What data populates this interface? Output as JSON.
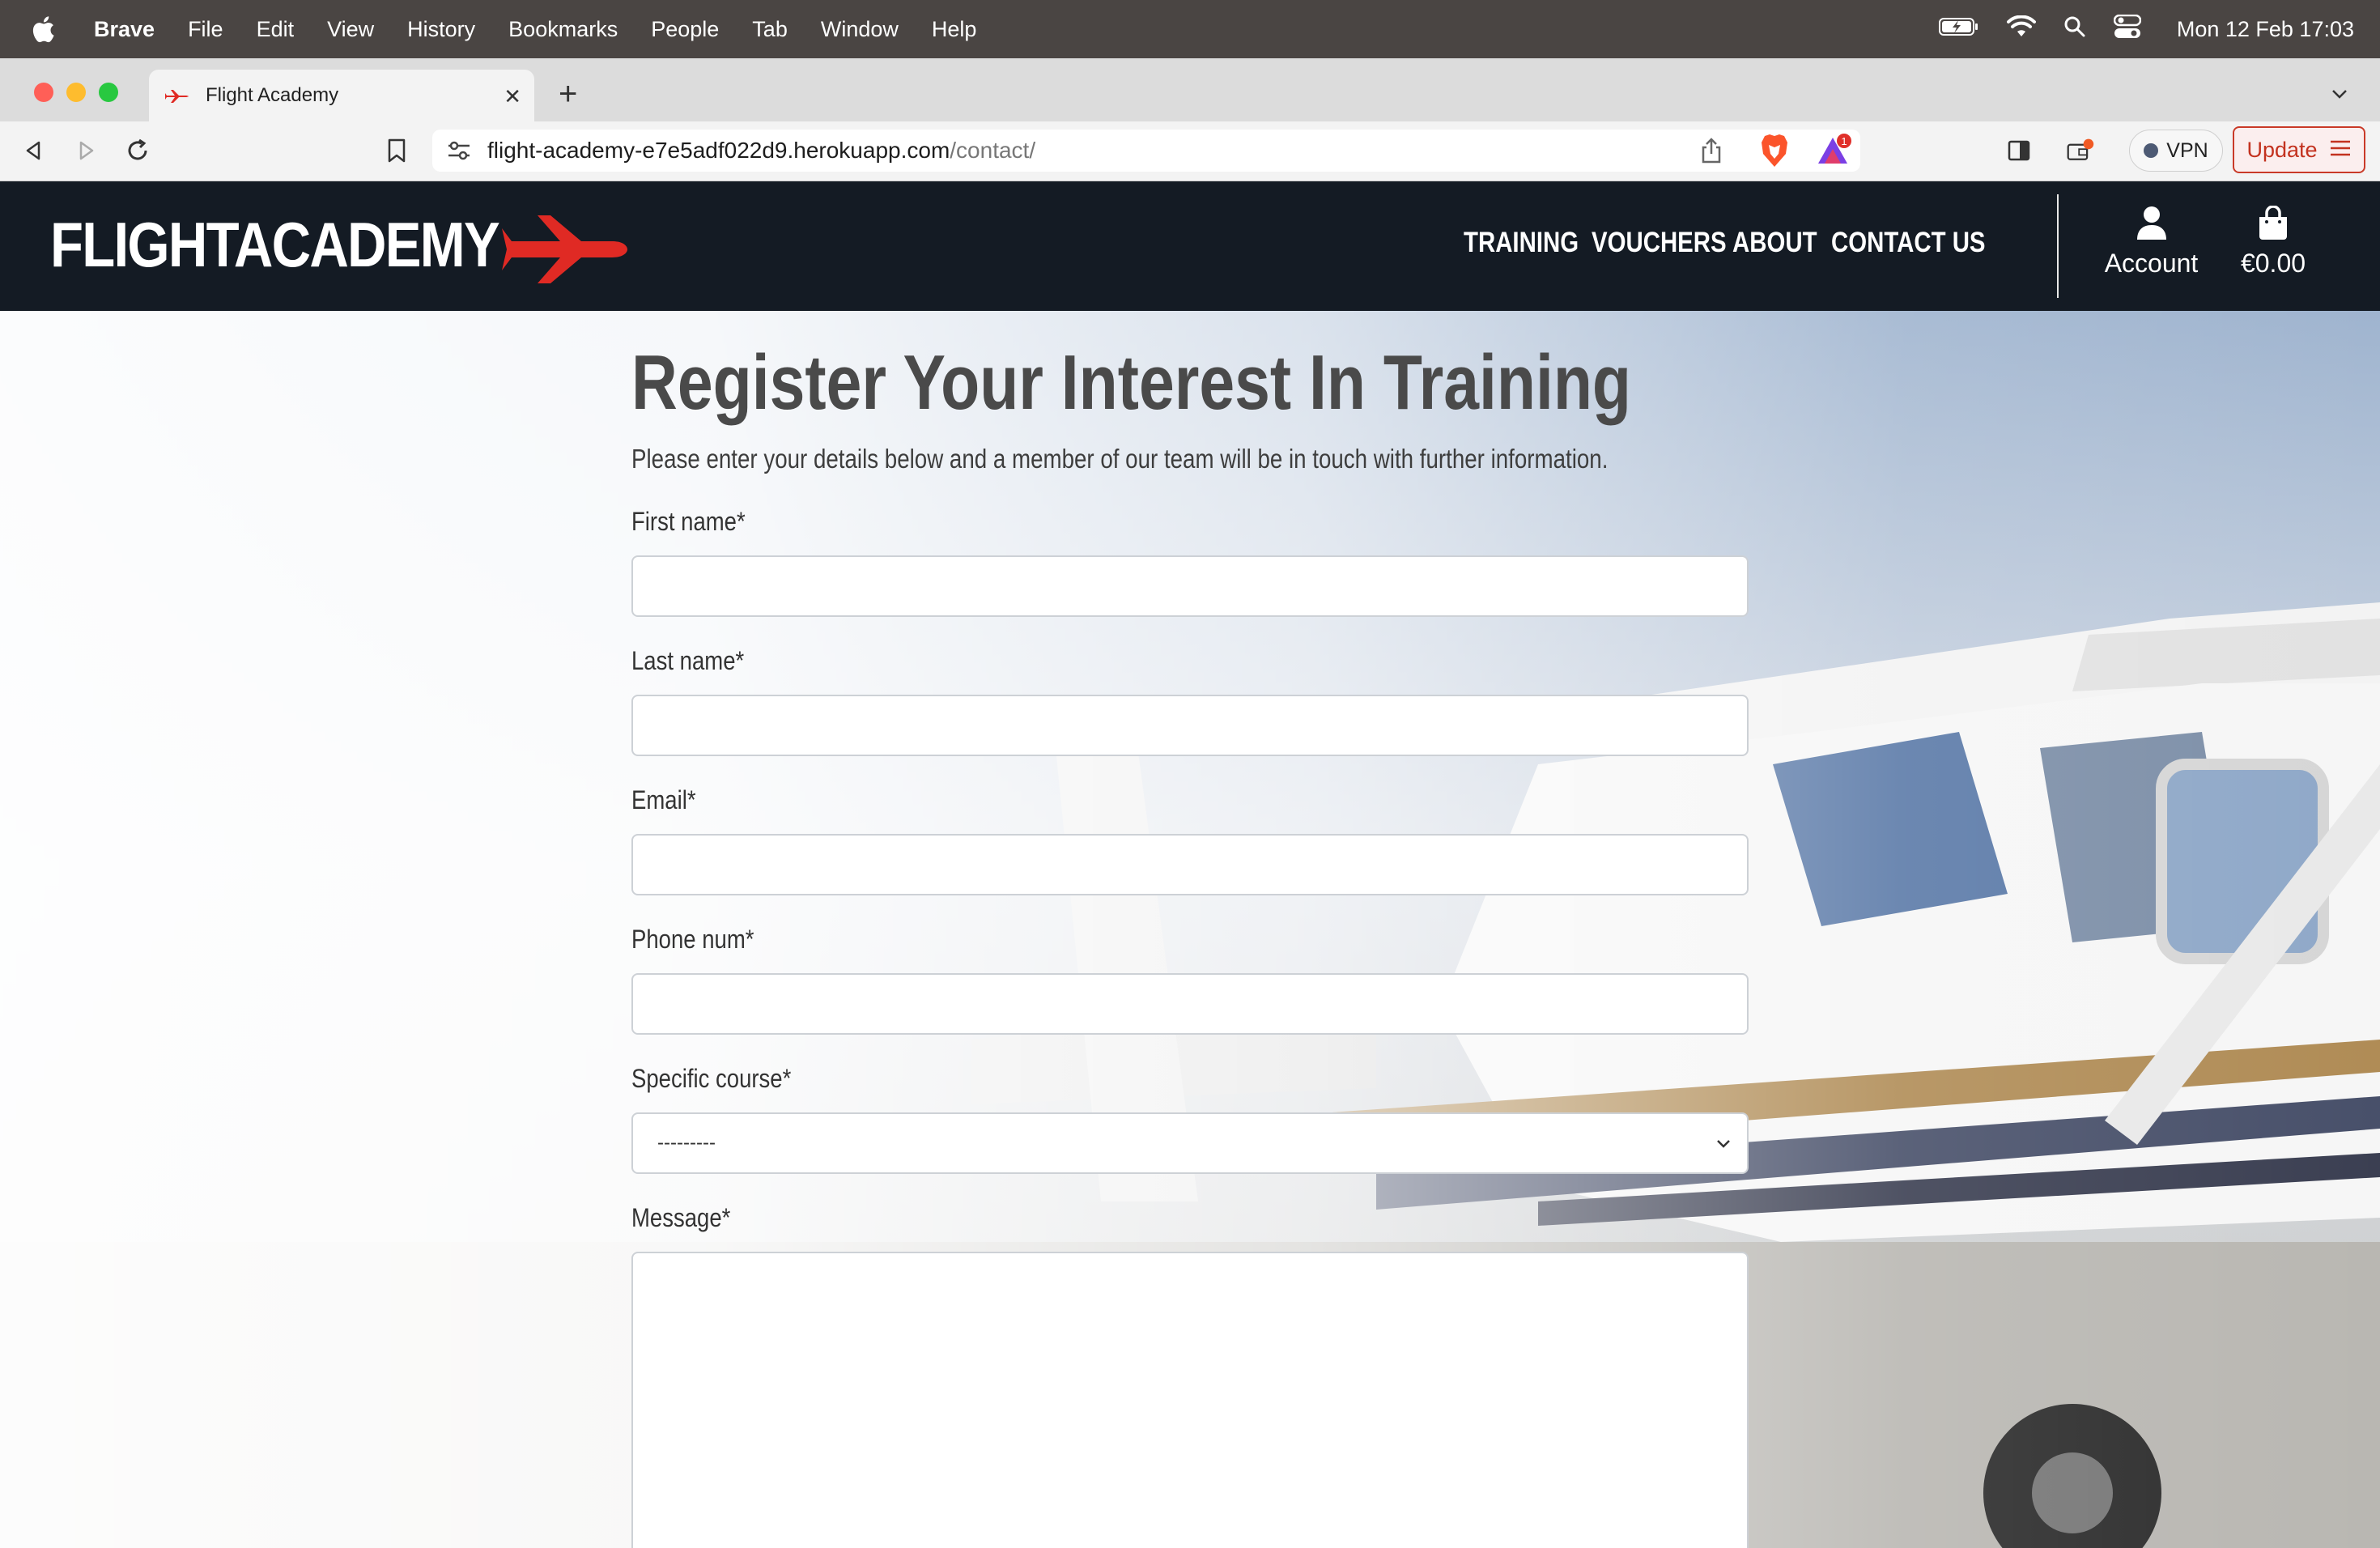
{
  "menubar": {
    "app_name": "Brave",
    "items": [
      "File",
      "Edit",
      "View",
      "History",
      "Bookmarks",
      "People",
      "Tab",
      "Window",
      "Help"
    ],
    "clock": "Mon 12 Feb  17:03"
  },
  "browser": {
    "tab_title": "Flight Academy",
    "url_host": "flight-academy-e7e5adf022d9.herokuapp.com",
    "url_path": "/contact/",
    "vpn_label": "VPN",
    "update_label": "Update",
    "rewards_badge": "1",
    "colors": {
      "close": "#ff5f57",
      "minimize": "#febc2e",
      "zoom": "#28c840"
    }
  },
  "site": {
    "logo_text": "FLIGHTACADEMY",
    "nav": [
      "TRAINING",
      "VOUCHERS",
      "ABOUT",
      "CONTACT US"
    ],
    "account_label": "Account",
    "bag_total": "€0.00",
    "brand_color": "#e02a24",
    "navbar_color": "#141b24"
  },
  "form": {
    "title": "Register Your Interest In Training",
    "subtitle": "Please enter your details below and a member of our team will be in touch with further information.",
    "fields": {
      "first_name": {
        "label": "First name*",
        "value": ""
      },
      "last_name": {
        "label": "Last name*",
        "value": ""
      },
      "email": {
        "label": "Email*",
        "value": ""
      },
      "phone": {
        "label": "Phone num*",
        "value": ""
      },
      "course": {
        "label": "Specific course*",
        "selected": "---------"
      },
      "message": {
        "label": "Message*",
        "value": ""
      }
    }
  }
}
